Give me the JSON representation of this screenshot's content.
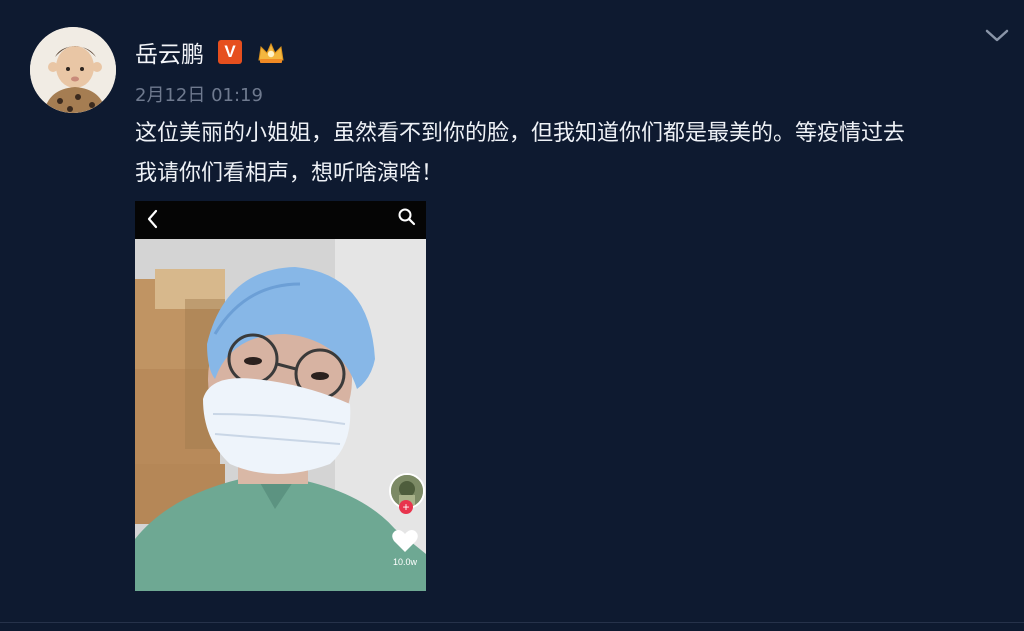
{
  "post": {
    "author": "岳云鹏",
    "timestamp": "2月12日 01:19",
    "text": "这位美丽的小姐姐，虽然看不到你的脸，但我知道你们都是最美的。等疫情过去\n我请你们看相声，想听啥演啥！",
    "badges": {
      "verified": "V",
      "verified_color": "#e64f1e",
      "member": "crown-icon"
    }
  },
  "video": {
    "like_count": "10.0w",
    "icons": [
      "back-arrow-icon",
      "search-icon",
      "heart-icon",
      "follow-plus-icon"
    ]
  },
  "colors": {
    "background": "#0e1a30",
    "text": "#eef1f6",
    "muted": "#6f7a8f"
  }
}
